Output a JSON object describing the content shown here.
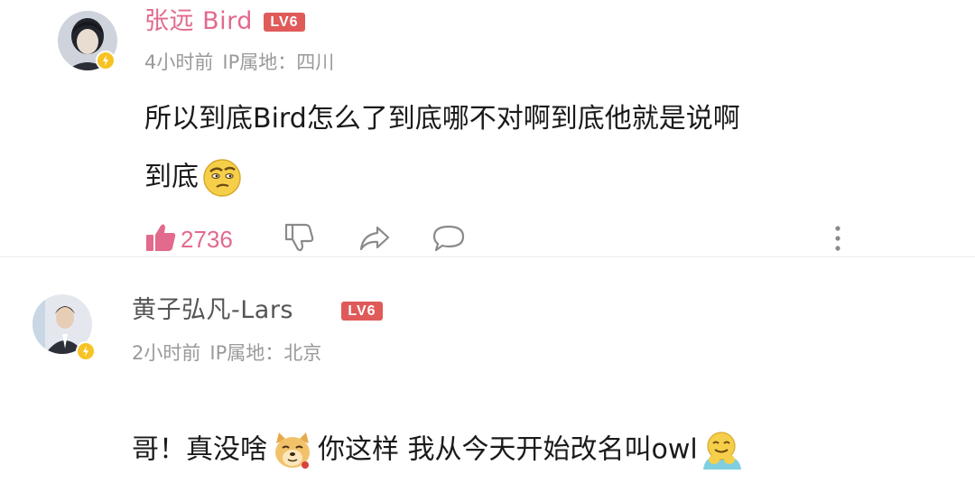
{
  "comments": [
    {
      "username": "张远 Bird",
      "level": "LV6",
      "time": "4小时前",
      "ip": "IP属地：四川",
      "text_line1": "所以到底Bird怎么了到底哪不对啊到底他就是说啊",
      "text_line2": "到底",
      "likes": "2736",
      "colors": {
        "username": "#e26a8c",
        "level_bg": "#e05a5a"
      }
    },
    {
      "username": "黄子弘凡-Lars",
      "level": "LV6",
      "time": "2小时前",
      "ip": "IP属地：北京",
      "text_part1": "哥！真没啥",
      "text_part2": "你这样 我从今天开始改名叫owl",
      "colors": {
        "username": "#555555",
        "level_bg": "#e05a5a"
      }
    }
  ],
  "icons": {
    "like": "thumbs-up-icon",
    "dislike": "thumbs-down-icon",
    "share": "share-arrow-icon",
    "reply": "comment-bubble-icon",
    "more": "more-vertical-icon",
    "verified": "verified-badge-icon"
  }
}
